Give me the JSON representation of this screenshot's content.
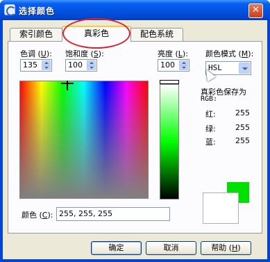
{
  "window": {
    "title": "选择颜色",
    "close_glyph": "✕"
  },
  "tabs": [
    {
      "label": "索引颜色",
      "active": false
    },
    {
      "label": "真彩色",
      "active": true
    },
    {
      "label": "配色系统",
      "active": false
    }
  ],
  "hue": {
    "label_pre": "色调 (",
    "key": "U",
    "label_post": "):",
    "value": "135"
  },
  "saturation": {
    "label_pre": "饱和度 (",
    "key": "S",
    "label_post": "):",
    "value": "100"
  },
  "luminance": {
    "label_pre": "亮度 (",
    "key": "L",
    "label_post": "):",
    "value": "100"
  },
  "color_model": {
    "label_pre": "颜色模式 (",
    "key": "M",
    "label_post": "):",
    "value": "HSL"
  },
  "rgb_section": {
    "title_line1": "真彩色保存为",
    "title_line2": "RGB:",
    "red_label": "红:",
    "red_value": "255",
    "green_label": "绿:",
    "green_value": "255",
    "blue_label": "蓝:",
    "blue_value": "255"
  },
  "color_field": {
    "label_pre": "颜色 (",
    "key": "C",
    "label_post": "):",
    "value": "255, 255, 255"
  },
  "buttons": {
    "ok": "确定",
    "cancel": "取消",
    "help_pre": "帮助 (",
    "help_key": "H",
    "help_post": ")"
  },
  "colors": {
    "new_swatch": "#00e000",
    "old_swatch": "#ffffff",
    "annotation": "#d8232a",
    "titlebar": "#0055e5"
  },
  "icons": {
    "app": "color-dialog-icon",
    "close": "close-icon",
    "spin_up": "chevron-up-icon",
    "spin_down": "chevron-down-icon",
    "select_arrow": "chevron-down-icon",
    "mouse": "mouse-pointer-icon"
  }
}
